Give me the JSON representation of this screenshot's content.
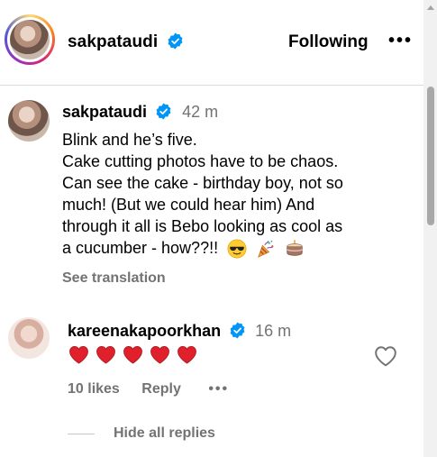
{
  "header": {
    "username": "sakpataudi",
    "follow_state": "Following",
    "more": "•••"
  },
  "caption": {
    "username": "sakpataudi",
    "time": "42 m",
    "lines": [
      "Blink and he’s five.",
      "Cake cutting photos have to be chaos.",
      "Can see the cake - birthday boy, not so",
      "much! (But we could hear him) And",
      "through it all is Bebo looking as cool as",
      "a cucumber - how??!!"
    ],
    "emojis": [
      "smiling-face-with-sunglasses",
      "party-popper",
      "birthday-cake"
    ],
    "see_translation": "See translation"
  },
  "reply": {
    "username": "kareenakapoorkhan",
    "time": "16 m",
    "hearts": 5,
    "likes": "10 likes",
    "reply_label": "Reply",
    "more": "•••"
  },
  "hide_replies": "Hide all replies",
  "colors": {
    "verified_blue": "#0095f6",
    "secondary_text": "#737373",
    "heart_red": "#e0202a"
  }
}
